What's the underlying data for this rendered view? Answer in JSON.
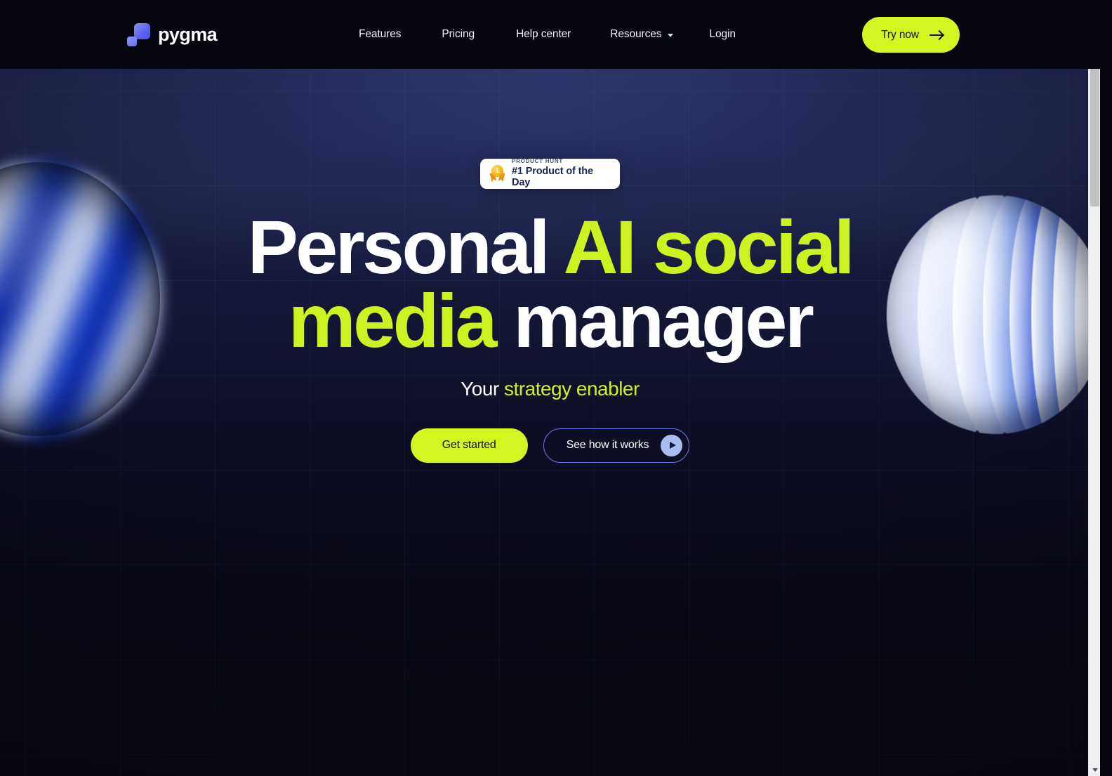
{
  "brand": {
    "name": "pygma",
    "logo_icon": "pygma-squares-logo",
    "logo_colors": [
      "#8b93f8",
      "#5a63ef"
    ]
  },
  "header": {
    "background": "#06060f",
    "nav_items": [
      {
        "label": "Features",
        "icon": null
      },
      {
        "label": "Pricing",
        "icon": null
      },
      {
        "label": "Help center",
        "icon": null
      },
      {
        "label": "Resources",
        "icon": "chevron-down-icon"
      },
      {
        "label": "Login",
        "icon": null
      }
    ],
    "cta": {
      "label": "Try now",
      "icon": "arrow-right-icon",
      "background": "#d4f521",
      "text_color": "#0d1117"
    }
  },
  "hero": {
    "badge": {
      "icon": "product-hunt-medal-icon",
      "medal_number": "1",
      "kicker": "PRODUCT HUNT",
      "title": "#1 Product of the Day",
      "background": "#ffffff",
      "title_color": "#1b2353"
    },
    "headline": {
      "line1_white": "Personal ",
      "line1_accent": "AI social",
      "line2_accent": "media",
      "line2_white": " manager"
    },
    "subheadline": {
      "white": "Your ",
      "accent": "strategy enabler"
    },
    "buttons": {
      "primary": {
        "label": "Get started",
        "background": "#d4f521"
      },
      "secondary": {
        "label": "See how it works",
        "icon": "play-circle-icon",
        "border_color": "#6d76e8",
        "icon_background": "#a9bdf2"
      }
    },
    "accent_color": "#ccf221",
    "background_top": "#2b3163",
    "background_bottom": "#090913",
    "decorations": [
      {
        "name": "blue-swirl-sphere-left",
        "position": "left"
      },
      {
        "name": "blue-petal-sphere-right",
        "position": "right"
      }
    ]
  },
  "scrollbar": {
    "up_icon": "caret-up-icon",
    "down_icon": "caret-down-icon",
    "thumb_color": "#c1c1c4",
    "track_color": "#f0f0f2"
  }
}
